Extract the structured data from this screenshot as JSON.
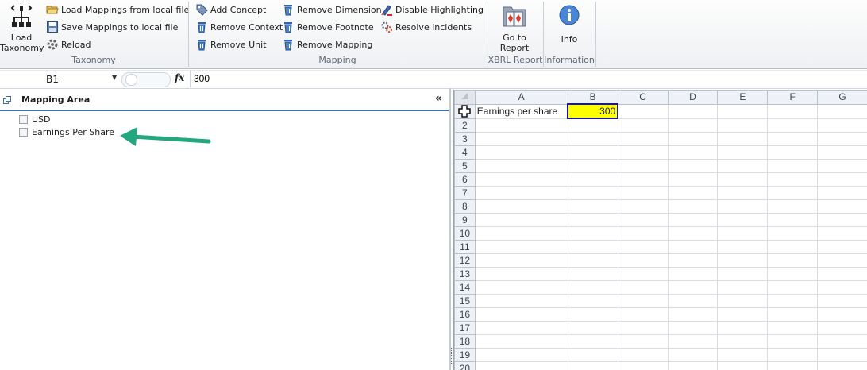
{
  "ribbon": {
    "taxonomy": {
      "load_taxonomy": "Load\nTaxonomy",
      "load_mappings": "Load Mappings from local file",
      "save_mappings": "Save Mappings to local file",
      "reload": "Reload",
      "group_label": "Taxonomy"
    },
    "mapping": {
      "add_concept": "Add Concept",
      "remove_context": "Remove Context",
      "remove_unit": "Remove Unit",
      "remove_dimension": "Remove Dimension",
      "remove_footnote": "Remove Footnote",
      "remove_mapping": "Remove Mapping",
      "disable_highlighting": "Disable Highlighting",
      "resolve_incidents": "Resolve incidents",
      "group_label": "Mapping"
    },
    "xbrl": {
      "go_to_report": "Go to\nReport",
      "group_label": "XBRL Report"
    },
    "information": {
      "info": "Info",
      "group_label": "Information"
    }
  },
  "formula_bar": {
    "name_box": "B1",
    "fx": "fx",
    "value": "300"
  },
  "mapping_area": {
    "title": "Mapping Area",
    "collapse": "«",
    "items": [
      {
        "label": "USD",
        "checked": false
      },
      {
        "label": "Earnings Per Share",
        "checked": false
      }
    ]
  },
  "sheet": {
    "columns": [
      "A",
      "B",
      "C",
      "D",
      "E",
      "F",
      "G"
    ],
    "selected_column": "B",
    "row_numbers": [
      "",
      "2",
      "3",
      "4",
      "5",
      "6",
      "7",
      "8",
      "9",
      "10",
      "11",
      "12",
      "13",
      "14",
      "15",
      "16",
      "17",
      "18",
      "19",
      "20"
    ],
    "cells": {
      "A1": "Earnings per share",
      "B1": "300"
    }
  },
  "colors": {
    "accent": "#3d6fb4",
    "selected_cell": "#ffff00",
    "selected_header": "#f9d978",
    "arrow": "#22a77f"
  }
}
